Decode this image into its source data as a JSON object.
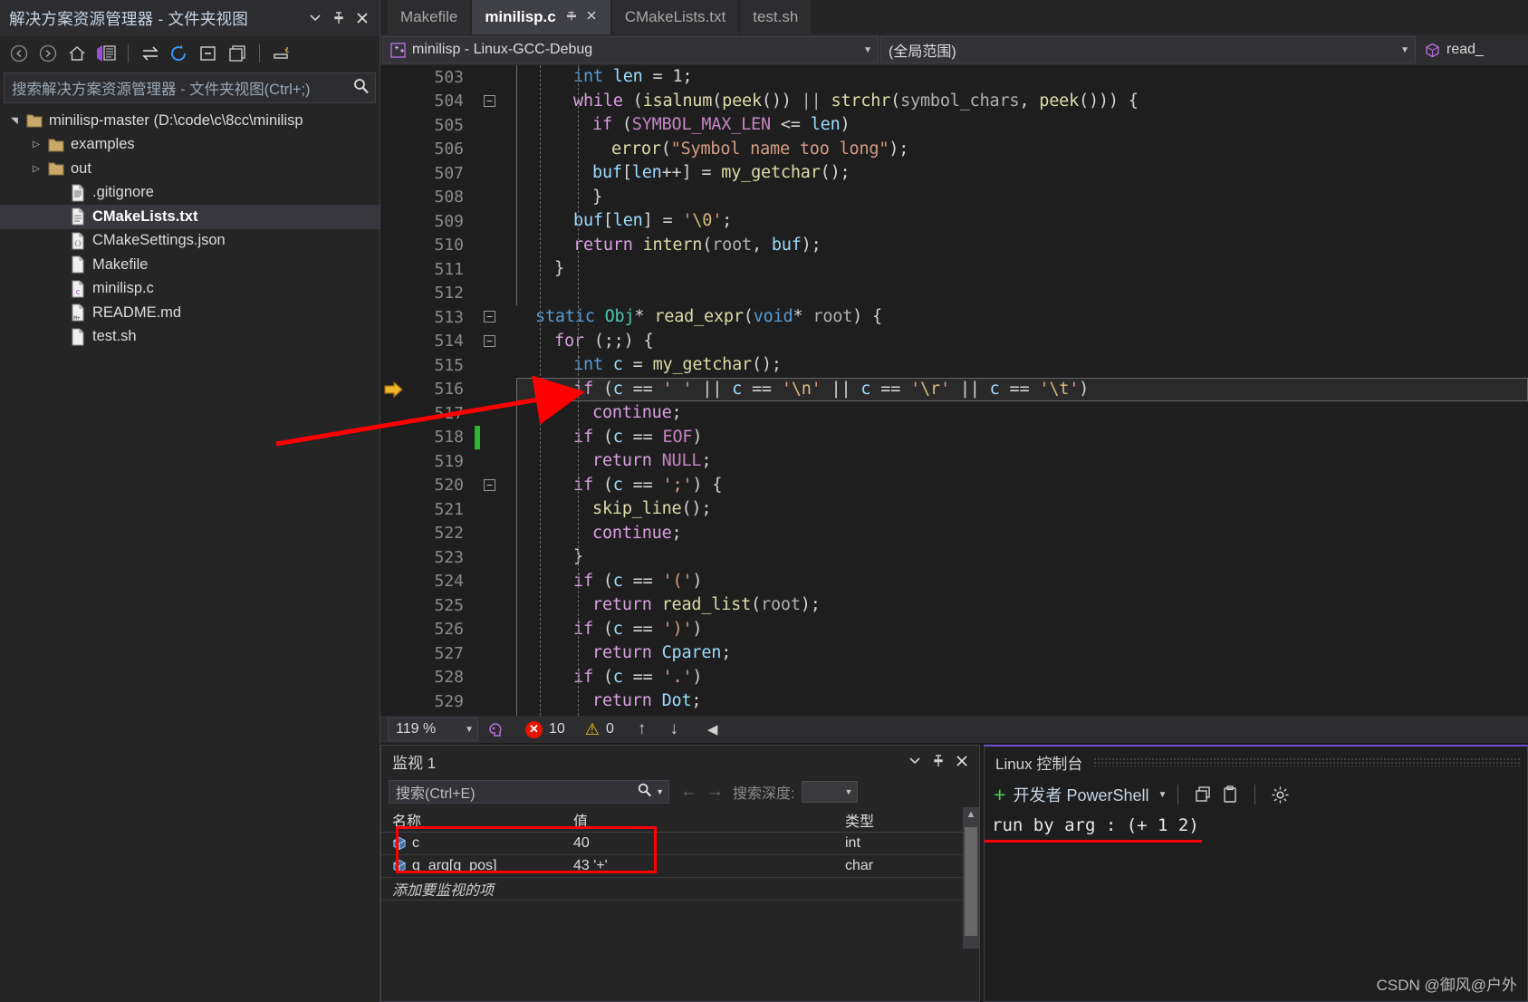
{
  "solution_explorer": {
    "title": "解决方案资源管理器 - 文件夹视图",
    "title_buttons": [
      {
        "name": "dropdown-icon",
        "glyph": "▼"
      },
      {
        "name": "pin-icon",
        "glyph": "📌"
      },
      {
        "name": "close-icon",
        "glyph": "✕"
      }
    ],
    "toolbar": [
      {
        "name": "back-icon",
        "glyph": "←"
      },
      {
        "name": "forward-icon",
        "glyph": "→"
      },
      {
        "name": "home-icon",
        "glyph": "⌂"
      },
      {
        "name": "switch-views-icon",
        "glyph": "▤"
      },
      {
        "name": "sync-with-active-document-icon",
        "glyph": "⇆"
      },
      {
        "name": "refresh-icon",
        "glyph": "↻"
      },
      {
        "name": "collapse-all-icon",
        "glyph": "⊟"
      },
      {
        "name": "show-all-files-icon",
        "glyph": "❐"
      },
      {
        "name": "properties-icon",
        "glyph": "⌸"
      }
    ],
    "search_placeholder": "搜索解决方案资源管理器 - 文件夹视图(Ctrl+;)",
    "search_icon": "search-icon",
    "tree": [
      {
        "label": "minilisp-master (D:\\code\\c\\8cc\\minilisp",
        "indent": 0,
        "twisty": "▲",
        "icon": "folder",
        "selected": false
      },
      {
        "label": "examples",
        "indent": 1,
        "twisty": "▷",
        "icon": "folder",
        "selected": false
      },
      {
        "label": "out",
        "indent": 1,
        "twisty": "▷",
        "icon": "folder",
        "selected": false
      },
      {
        "label": ".gitignore",
        "indent": 2,
        "twisty": "",
        "icon": "file-lines",
        "selected": false
      },
      {
        "label": "CMakeLists.txt",
        "indent": 2,
        "twisty": "",
        "icon": "file-text",
        "selected": true
      },
      {
        "label": "CMakeSettings.json",
        "indent": 2,
        "twisty": "",
        "icon": "file-json",
        "selected": false
      },
      {
        "label": "Makefile",
        "indent": 2,
        "twisty": "",
        "icon": "file-blank",
        "selected": false
      },
      {
        "label": "minilisp.c",
        "indent": 2,
        "twisty": "",
        "icon": "file-c",
        "selected": false
      },
      {
        "label": "README.md",
        "indent": 2,
        "twisty": "",
        "icon": "file-md",
        "selected": false
      },
      {
        "label": "test.sh",
        "indent": 2,
        "twisty": "",
        "icon": "file-blank-2",
        "selected": false
      }
    ]
  },
  "tabs": [
    {
      "label": "Makefile",
      "active": false,
      "pinned": false
    },
    {
      "label": "minilisp.c",
      "active": true,
      "pinned": true
    },
    {
      "label": "CMakeLists.txt",
      "active": false,
      "pinned": false
    },
    {
      "label": "test.sh",
      "active": false,
      "pinned": false
    }
  ],
  "navbar": {
    "project_icon": "cpp-project-icon",
    "project": "minilisp - Linux-GCC-Debug",
    "scope": "(全局范围)",
    "member_icon": "method-cube-icon",
    "member": "read_"
  },
  "editor": {
    "lines": [
      {
        "num": "503",
        "fold": "",
        "change": false,
        "current": false,
        "indent": 3,
        "tokens": [
          {
            "t": "int",
            "c": "kb"
          },
          {
            "t": " ",
            "c": "p"
          },
          {
            "t": "len",
            "c": "v"
          },
          {
            "t": " = ",
            "c": "p"
          },
          {
            "t": "1",
            "c": "p"
          },
          {
            "t": ";",
            "c": "p"
          }
        ]
      },
      {
        "num": "504",
        "fold": "minus",
        "change": false,
        "current": false,
        "indent": 3,
        "tokens": [
          {
            "t": "while",
            "c": "k"
          },
          {
            "t": " (",
            "c": "p"
          },
          {
            "t": "isalnum",
            "c": "f"
          },
          {
            "t": "(",
            "c": "p"
          },
          {
            "t": "peek",
            "c": "f"
          },
          {
            "t": "()) ",
            "c": "p"
          },
          {
            "t": "||",
            "c": "g"
          },
          {
            "t": " ",
            "c": "p"
          },
          {
            "t": "strchr",
            "c": "f"
          },
          {
            "t": "(",
            "c": "p"
          },
          {
            "t": "symbol_chars",
            "c": "g"
          },
          {
            "t": ", ",
            "c": "p"
          },
          {
            "t": "peek",
            "c": "f"
          },
          {
            "t": "())) {",
            "c": "p"
          }
        ]
      },
      {
        "num": "505",
        "fold": "",
        "change": false,
        "current": false,
        "indent": 4,
        "tokens": [
          {
            "t": "if",
            "c": "k"
          },
          {
            "t": " (",
            "c": "p"
          },
          {
            "t": "SYMBOL_MAX_LEN",
            "c": "m"
          },
          {
            "t": " <= ",
            "c": "p"
          },
          {
            "t": "len",
            "c": "v"
          },
          {
            "t": ")",
            "c": "p"
          }
        ]
      },
      {
        "num": "506",
        "fold": "",
        "change": false,
        "current": false,
        "indent": 5,
        "tokens": [
          {
            "t": "error",
            "c": "f"
          },
          {
            "t": "(",
            "c": "p"
          },
          {
            "t": "\"Symbol name too long\"",
            "c": "s"
          },
          {
            "t": ");",
            "c": "p"
          }
        ]
      },
      {
        "num": "507",
        "fold": "",
        "change": false,
        "current": false,
        "indent": 4,
        "tokens": [
          {
            "t": "buf",
            "c": "v"
          },
          {
            "t": "[",
            "c": "p"
          },
          {
            "t": "len",
            "c": "v"
          },
          {
            "t": "++] = ",
            "c": "p"
          },
          {
            "t": "my_getchar",
            "c": "f"
          },
          {
            "t": "();",
            "c": "p"
          }
        ]
      },
      {
        "num": "508",
        "fold": "",
        "change": false,
        "current": false,
        "indent": 4,
        "tokens": [
          {
            "t": "}",
            "c": "p"
          }
        ]
      },
      {
        "num": "509",
        "fold": "",
        "change": false,
        "current": false,
        "indent": 3,
        "tokens": [
          {
            "t": "buf",
            "c": "v"
          },
          {
            "t": "[",
            "c": "p"
          },
          {
            "t": "len",
            "c": "v"
          },
          {
            "t": "] = ",
            "c": "p"
          },
          {
            "t": "'",
            "c": "s"
          },
          {
            "t": "\\0",
            "c": "esc"
          },
          {
            "t": "'",
            "c": "s"
          },
          {
            "t": ";",
            "c": "p"
          }
        ]
      },
      {
        "num": "510",
        "fold": "",
        "change": false,
        "current": false,
        "indent": 3,
        "tokens": [
          {
            "t": "return",
            "c": "k"
          },
          {
            "t": " ",
            "c": "p"
          },
          {
            "t": "intern",
            "c": "f"
          },
          {
            "t": "(",
            "c": "p"
          },
          {
            "t": "root",
            "c": "g"
          },
          {
            "t": ", ",
            "c": "p"
          },
          {
            "t": "buf",
            "c": "v"
          },
          {
            "t": ");",
            "c": "p"
          }
        ]
      },
      {
        "num": "511",
        "fold": "",
        "change": false,
        "current": false,
        "indent": 2,
        "tokens": [
          {
            "t": "}",
            "c": "p"
          }
        ]
      },
      {
        "num": "512",
        "fold": "",
        "change": false,
        "current": false,
        "indent": 0,
        "tokens": []
      },
      {
        "num": "513",
        "fold": "minus-top",
        "change": false,
        "current": false,
        "indent": 1,
        "tokens": [
          {
            "t": "static",
            "c": "kb"
          },
          {
            "t": " ",
            "c": "p"
          },
          {
            "t": "Obj",
            "c": "t"
          },
          {
            "t": "* ",
            "c": "p"
          },
          {
            "t": "read_expr",
            "c": "f"
          },
          {
            "t": "(",
            "c": "p"
          },
          {
            "t": "void",
            "c": "kb"
          },
          {
            "t": "* ",
            "c": "p"
          },
          {
            "t": "root",
            "c": "g"
          },
          {
            "t": ") {",
            "c": "p"
          }
        ]
      },
      {
        "num": "514",
        "fold": "minus",
        "change": false,
        "current": false,
        "indent": 2,
        "tokens": [
          {
            "t": "for",
            "c": "k"
          },
          {
            "t": " (;;) {",
            "c": "p"
          }
        ]
      },
      {
        "num": "515",
        "fold": "",
        "change": false,
        "current": false,
        "indent": 3,
        "tokens": [
          {
            "t": "int",
            "c": "kb"
          },
          {
            "t": " ",
            "c": "p"
          },
          {
            "t": "c",
            "c": "v"
          },
          {
            "t": " = ",
            "c": "p"
          },
          {
            "t": "my_getchar",
            "c": "f"
          },
          {
            "t": "();",
            "c": "p"
          }
        ]
      },
      {
        "num": "516",
        "fold": "",
        "change": false,
        "current": true,
        "indent": 3,
        "tokens": [
          {
            "t": "if",
            "c": "k"
          },
          {
            "t": " (",
            "c": "p"
          },
          {
            "t": "c",
            "c": "v"
          },
          {
            "t": " == ",
            "c": "p"
          },
          {
            "t": "' '",
            "c": "s"
          },
          {
            "t": " || ",
            "c": "p"
          },
          {
            "t": "c",
            "c": "v"
          },
          {
            "t": " == ",
            "c": "p"
          },
          {
            "t": "'",
            "c": "s"
          },
          {
            "t": "\\n",
            "c": "esc"
          },
          {
            "t": "'",
            "c": "s"
          },
          {
            "t": " || ",
            "c": "p"
          },
          {
            "t": "c",
            "c": "v"
          },
          {
            "t": " == ",
            "c": "p"
          },
          {
            "t": "'",
            "c": "s"
          },
          {
            "t": "\\r",
            "c": "esc"
          },
          {
            "t": "'",
            "c": "s"
          },
          {
            "t": " || ",
            "c": "p"
          },
          {
            "t": "c",
            "c": "v"
          },
          {
            "t": " == ",
            "c": "p"
          },
          {
            "t": "'",
            "c": "s"
          },
          {
            "t": "\\t",
            "c": "esc"
          },
          {
            "t": "'",
            "c": "s"
          },
          {
            "t": ")",
            "c": "p"
          }
        ]
      },
      {
        "num": "517",
        "fold": "",
        "change": false,
        "current": false,
        "indent": 4,
        "tokens": [
          {
            "t": "continue",
            "c": "k"
          },
          {
            "t": ";",
            "c": "p"
          }
        ]
      },
      {
        "num": "518",
        "fold": "",
        "change": true,
        "current": false,
        "indent": 3,
        "tokens": [
          {
            "t": "if",
            "c": "k"
          },
          {
            "t": " (",
            "c": "p"
          },
          {
            "t": "c",
            "c": "v"
          },
          {
            "t": " == ",
            "c": "p"
          },
          {
            "t": "EOF",
            "c": "m"
          },
          {
            "t": ")",
            "c": "p"
          }
        ]
      },
      {
        "num": "519",
        "fold": "",
        "change": false,
        "current": false,
        "indent": 4,
        "tokens": [
          {
            "t": "return",
            "c": "k"
          },
          {
            "t": " ",
            "c": "p"
          },
          {
            "t": "NULL",
            "c": "m"
          },
          {
            "t": ";",
            "c": "p"
          }
        ]
      },
      {
        "num": "520",
        "fold": "minus",
        "change": false,
        "current": false,
        "indent": 3,
        "tokens": [
          {
            "t": "if",
            "c": "k"
          },
          {
            "t": " (",
            "c": "p"
          },
          {
            "t": "c",
            "c": "v"
          },
          {
            "t": " == ",
            "c": "p"
          },
          {
            "t": "';'",
            "c": "s"
          },
          {
            "t": ") {",
            "c": "p"
          }
        ]
      },
      {
        "num": "521",
        "fold": "",
        "change": false,
        "current": false,
        "indent": 4,
        "tokens": [
          {
            "t": "skip_line",
            "c": "f"
          },
          {
            "t": "();",
            "c": "p"
          }
        ]
      },
      {
        "num": "522",
        "fold": "",
        "change": false,
        "current": false,
        "indent": 4,
        "tokens": [
          {
            "t": "continue",
            "c": "k"
          },
          {
            "t": ";",
            "c": "p"
          }
        ]
      },
      {
        "num": "523",
        "fold": "",
        "change": false,
        "current": false,
        "indent": 3,
        "tokens": [
          {
            "t": "}",
            "c": "p"
          }
        ]
      },
      {
        "num": "524",
        "fold": "",
        "change": false,
        "current": false,
        "indent": 3,
        "tokens": [
          {
            "t": "if",
            "c": "k"
          },
          {
            "t": " (",
            "c": "p"
          },
          {
            "t": "c",
            "c": "v"
          },
          {
            "t": " == ",
            "c": "p"
          },
          {
            "t": "'('",
            "c": "s"
          },
          {
            "t": ")",
            "c": "p"
          }
        ]
      },
      {
        "num": "525",
        "fold": "",
        "change": false,
        "current": false,
        "indent": 4,
        "tokens": [
          {
            "t": "return",
            "c": "k"
          },
          {
            "t": " ",
            "c": "p"
          },
          {
            "t": "read_list",
            "c": "f"
          },
          {
            "t": "(",
            "c": "p"
          },
          {
            "t": "root",
            "c": "g"
          },
          {
            "t": ");",
            "c": "p"
          }
        ]
      },
      {
        "num": "526",
        "fold": "",
        "change": false,
        "current": false,
        "indent": 3,
        "tokens": [
          {
            "t": "if",
            "c": "k"
          },
          {
            "t": " (",
            "c": "p"
          },
          {
            "t": "c",
            "c": "v"
          },
          {
            "t": " == ",
            "c": "p"
          },
          {
            "t": "')'",
            "c": "s"
          },
          {
            "t": ")",
            "c": "p"
          }
        ]
      },
      {
        "num": "527",
        "fold": "",
        "change": false,
        "current": false,
        "indent": 4,
        "tokens": [
          {
            "t": "return",
            "c": "k"
          },
          {
            "t": " ",
            "c": "p"
          },
          {
            "t": "Cparen",
            "c": "v"
          },
          {
            "t": ";",
            "c": "p"
          }
        ]
      },
      {
        "num": "528",
        "fold": "",
        "change": false,
        "current": false,
        "indent": 3,
        "tokens": [
          {
            "t": "if",
            "c": "k"
          },
          {
            "t": " (",
            "c": "p"
          },
          {
            "t": "c",
            "c": "v"
          },
          {
            "t": " == ",
            "c": "p"
          },
          {
            "t": "'.'",
            "c": "s"
          },
          {
            "t": ")",
            "c": "p"
          }
        ]
      },
      {
        "num": "529",
        "fold": "",
        "change": false,
        "current": false,
        "indent": 4,
        "tokens": [
          {
            "t": "return",
            "c": "k"
          },
          {
            "t": " ",
            "c": "p"
          },
          {
            "t": "Dot",
            "c": "v"
          },
          {
            "t": ";",
            "c": "p"
          }
        ]
      }
    ],
    "current_line_marker": "execution-pointer-icon"
  },
  "editor_status": {
    "zoom": "119 %",
    "zoom_caret": "▾",
    "feedback_icon": "intellicode-icon",
    "error_icon": "error-icon",
    "error_count": "10",
    "warning_icon": "warning-icon",
    "warning_count": "0",
    "prev_icon": "arrow-up-icon",
    "next_icon": "arrow-down-icon",
    "collapse_icon": "arrow-left-icon"
  },
  "watch": {
    "title": "监视 1",
    "title_buttons": [
      {
        "name": "dropdown-icon",
        "glyph": "▼"
      },
      {
        "name": "pin-icon",
        "glyph": "📌"
      },
      {
        "name": "close-icon",
        "glyph": "✕"
      }
    ],
    "search_placeholder": "搜索(Ctrl+E)",
    "search_icon": "search-icon",
    "search_caret": "▾",
    "back_icon": "arrow-left-icon",
    "forward_icon": "arrow-right-icon",
    "depth_label": "搜索深度:",
    "depth_value": "",
    "columns": [
      "名称",
      "值",
      "类型"
    ],
    "rows": [
      {
        "name": "c",
        "value": "40",
        "type": "int",
        "icon": "variable-cube-icon"
      },
      {
        "name": "g_arg[g_pos]",
        "value": "43 '+'",
        "type": "char",
        "icon": "variable-cube-icon"
      }
    ],
    "add_placeholder": "添加要监视的项",
    "highlight_color": "#ff0000"
  },
  "console": {
    "title": "Linux 控制台",
    "add_icon": "plus-icon",
    "shell": "开发者 PowerShell",
    "shell_caret": "▾",
    "copy_icon": "copy-icon",
    "paste_icon": "paste-icon",
    "settings_icon": "gear-icon",
    "output": "run by arg : (+ 1 2)",
    "underline_color": "#ff0000",
    "accent_color": "#6f4fd8"
  },
  "watermark": "CSDN @御风@户外",
  "annotation": {
    "arrow_color": "#ff0000",
    "target_line": "516"
  }
}
